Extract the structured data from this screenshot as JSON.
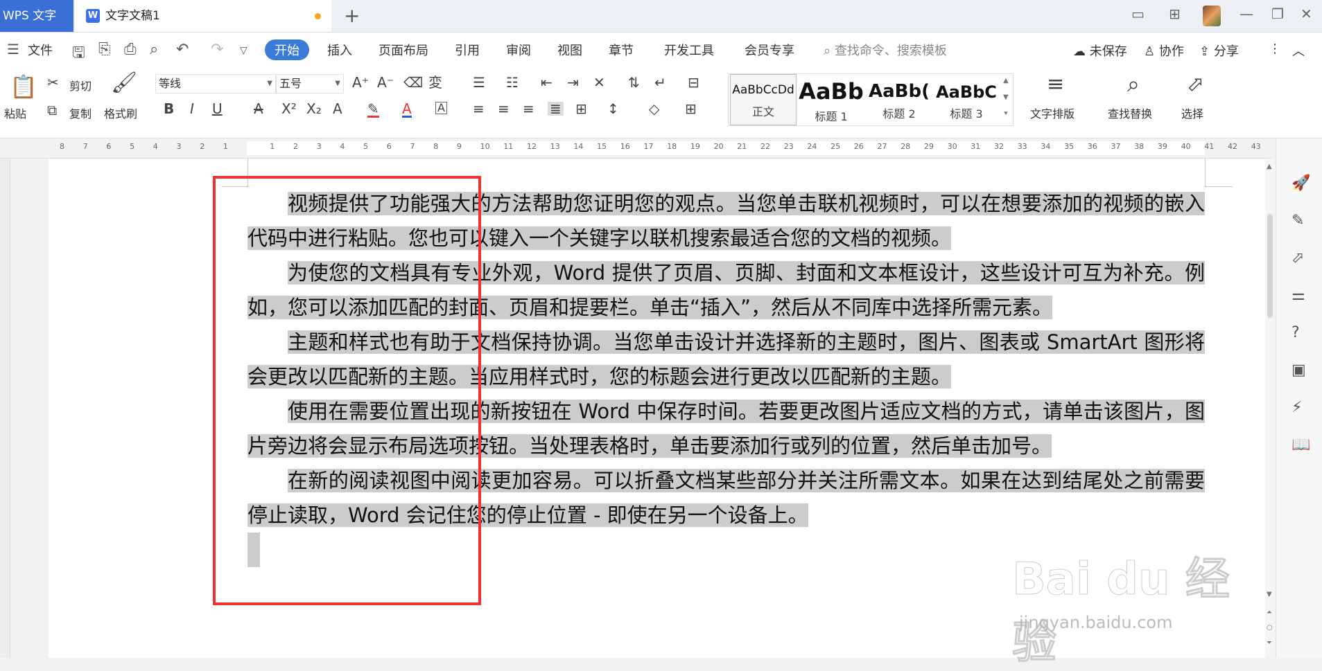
{
  "titlebar": {
    "app_name": "WPS 文字",
    "doc_tab_title": "文字文稿1",
    "new_tab": "+",
    "win_controls": [
      "▭",
      "⊞",
      "—",
      "❐",
      "✕"
    ]
  },
  "menu": {
    "items": [
      "文件",
      "开始",
      "插入",
      "页面布局",
      "引用",
      "审阅",
      "视图",
      "章节",
      "开发工具",
      "会员专享"
    ],
    "search_placeholder": "查找命令、搜索模板",
    "unsaved": "未保存",
    "collaborate": "协作",
    "share": "分享"
  },
  "ribbon": {
    "paste": "粘贴",
    "cut": "剪切",
    "copy": "复制",
    "format_painter": "格式刷",
    "font_name": "等线",
    "font_size": "五号",
    "styles": [
      {
        "sample": "AaBbCcDd",
        "name": "正文"
      },
      {
        "sample": "AaBb",
        "name": "标题 1"
      },
      {
        "sample": "AaBb(",
        "name": "标题 2"
      },
      {
        "sample": "AaBbC",
        "name": "标题 3"
      }
    ],
    "text_layout": "文字排版",
    "find_replace": "查找替换",
    "select": "选择"
  },
  "ruler": {
    "ticks": [
      "8",
      "7",
      "6",
      "5",
      "4",
      "3",
      "2",
      "1",
      "",
      "1",
      "2",
      "3",
      "4",
      "5",
      "6",
      "7",
      "8",
      "9",
      "10",
      "11",
      "12",
      "13",
      "14",
      "15",
      "16",
      "17",
      "18",
      "19",
      "20",
      "21",
      "22",
      "23",
      "24",
      "25",
      "26",
      "27",
      "28",
      "29",
      "30",
      "31",
      "32",
      "33",
      "34",
      "35",
      "36",
      "37",
      "38",
      "39",
      "40",
      "41",
      "42",
      "43"
    ]
  },
  "document": {
    "paragraphs": [
      "视频提供了功能强大的方法帮助您证明您的观点。当您单击联机视频时，可以在想要添加的视频的嵌入代码中进行粘贴。您也可以键入一个关键字以联机搜索最适合您的文档的视频。",
      "为使您的文档具有专业外观，Word 提供了页眉、页脚、封面和文本框设计，这些设计可互为补充。例如，您可以添加匹配的封面、页眉和提要栏。单击“插入”，然后从不同库中选择所需元素。",
      "主题和样式也有助于文档保持协调。当您单击设计并选择新的主题时，图片、图表或 SmartArt 图形将会更改以匹配新的主题。当应用样式时，您的标题会进行更改以匹配新的主题。",
      "使用在需要位置出现的新按钮在 Word 中保存时间。若要更改图片适应文档的方式，请单击该图片，图片旁边将会显示布局选项按钮。当处理表格时，单击要添加行或列的位置，然后单击加号。",
      "在新的阅读视图中阅读更加容易。可以折叠文档某些部分并关注所需文本。如果在达到结尾处之前需要停止读取，Word 会记住您的停止位置 - 即使在另一个设备上。"
    ]
  },
  "watermark": {
    "logo": "Bai du 经验",
    "url": "jingyan.baidu.com"
  },
  "colors": {
    "accent": "#3a7bd8",
    "selection": "#cccccc",
    "highlight_box": "#ee3333"
  }
}
